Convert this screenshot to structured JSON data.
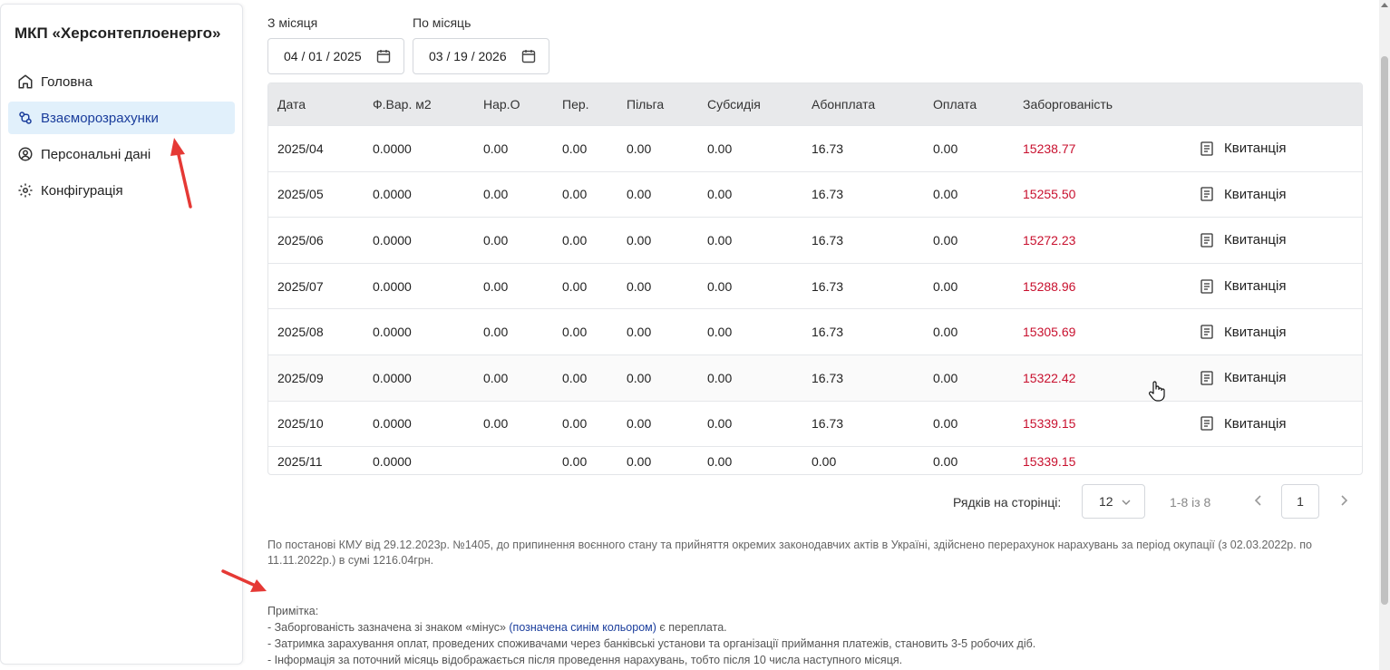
{
  "sidebar": {
    "brand": "МКП «Херсонтеплоенерго»",
    "items": [
      {
        "label": "Головна",
        "icon": "home-icon",
        "active": false
      },
      {
        "label": "Взаєморозрахунки",
        "icon": "exchange-icon",
        "active": true
      },
      {
        "label": "Персональні дані",
        "icon": "user-icon",
        "active": false
      },
      {
        "label": "Конфігурація",
        "icon": "gear-icon",
        "active": false
      }
    ]
  },
  "filters": {
    "from_label": "З місяця",
    "from_value": "04 / 01 / 2025",
    "to_label": "По місяць",
    "to_value": "03 / 19 / 2026"
  },
  "table": {
    "columns": [
      "Дата",
      "Ф.Вар. м2",
      "Нар.О",
      "Пер.",
      "Пільга",
      "Субсидія",
      "Абонплата",
      "Оплата",
      "Заборгованість"
    ],
    "receipt_label": "Квитанція",
    "rows": [
      [
        "2025/04",
        "0.0000",
        "0.00",
        "0.00",
        "0.00",
        "0.00",
        "16.73",
        "0.00",
        "15238.77"
      ],
      [
        "2025/05",
        "0.0000",
        "0.00",
        "0.00",
        "0.00",
        "0.00",
        "16.73",
        "0.00",
        "15255.50"
      ],
      [
        "2025/06",
        "0.0000",
        "0.00",
        "0.00",
        "0.00",
        "0.00",
        "16.73",
        "0.00",
        "15272.23"
      ],
      [
        "2025/07",
        "0.0000",
        "0.00",
        "0.00",
        "0.00",
        "0.00",
        "16.73",
        "0.00",
        "15288.96"
      ],
      [
        "2025/08",
        "0.0000",
        "0.00",
        "0.00",
        "0.00",
        "0.00",
        "16.73",
        "0.00",
        "15305.69"
      ],
      [
        "2025/09",
        "0.0000",
        "0.00",
        "0.00",
        "0.00",
        "0.00",
        "16.73",
        "0.00",
        "15322.42"
      ],
      [
        "2025/10",
        "0.0000",
        "0.00",
        "0.00",
        "0.00",
        "0.00",
        "16.73",
        "0.00",
        "15339.15"
      ],
      [
        "2025/11",
        "0.0000",
        "",
        "0.00",
        "0.00",
        "0.00",
        "0.00",
        "0.00",
        "15339.15"
      ]
    ],
    "row_has_receipt": [
      true,
      true,
      true,
      true,
      true,
      true,
      true,
      false
    ]
  },
  "pagination": {
    "rows_label": "Рядків на сторінці:",
    "rows_value": "12",
    "range": "1-8 із 8",
    "page": "1"
  },
  "notice": "По постанові КМУ від 29.12.2023р. №1405, до припинення воєнного стану та прийняття окремих законодавчих актів в Україні, здійснено перерахунок нарахувань за період окупації (з 02.03.2022р. по 11.11.2022р.) в сумі 1216.04грн.",
  "note": {
    "title": "Примітка:",
    "line1_before": "- Заборгованість зазначена зі знаком «мінус» ",
    "line1_blue": "(позначена синім кольором)",
    "line1_after": " є переплата.",
    "line2": "- Затримка зарахування оплат, проведених споживачами через банківські установи та організації приймання платежів, становить 3-5 робочих діб.",
    "line3": "- Інформація за поточний місяць відображається після проведення нарахувань, тобто після 10 числа наступного місяця."
  },
  "colors": {
    "debt": "#c8102e",
    "active_bg": "#e1f0fb",
    "accent_blue": "#1a3d9c",
    "arrow": "#e53935"
  }
}
